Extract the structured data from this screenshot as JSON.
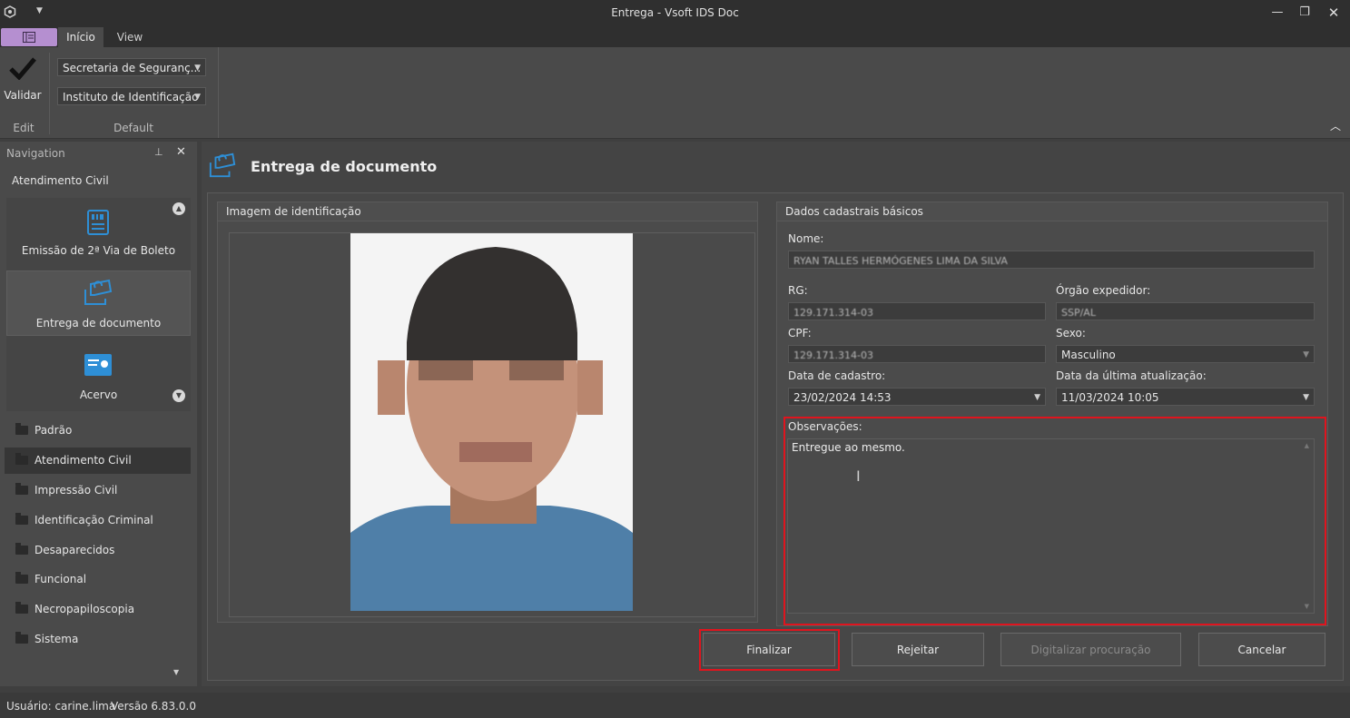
{
  "window": {
    "title": "Entrega - Vsoft IDS Doc"
  },
  "ribbon": {
    "tabs": [
      {
        "label": "Início"
      },
      {
        "label": "View"
      }
    ],
    "validar_label": "Validar",
    "combo1": "Secretaria de Seguranç...",
    "combo2": "Instituto de Identificação",
    "group_edit": "Edit",
    "group_default": "Default"
  },
  "navigation": {
    "header": "Navigation",
    "section": "Atendimento Civil",
    "tiles": [
      {
        "label": "Emissão de 2ª Via de Boleto",
        "icon": "barcode-icon"
      },
      {
        "label": "Entrega de documento",
        "icon": "document-delivery-icon"
      },
      {
        "label": "Acervo",
        "icon": "id-card-icon"
      }
    ],
    "folders": [
      {
        "label": "Padrão"
      },
      {
        "label": "Atendimento Civil"
      },
      {
        "label": "Impressão Civil"
      },
      {
        "label": "Identificação Criminal"
      },
      {
        "label": "Desaparecidos"
      },
      {
        "label": "Funcional"
      },
      {
        "label": "Necropapiloscopia"
      },
      {
        "label": "Sistema"
      }
    ]
  },
  "page": {
    "title": "Entrega de documento",
    "image_panel_title": "Imagem de identificação",
    "data_panel_title": "Dados cadastrais básicos",
    "fields": {
      "nome_label": "Nome:",
      "nome_value": "RYAN TALLES HERMÓGENES LIMA DA SILVA",
      "rg_label": "RG:",
      "rg_value": "129.171.314-03",
      "orgao_label": "Órgão expedidor:",
      "orgao_value": "SSP/AL",
      "cpf_label": "CPF:",
      "cpf_value": "129.171.314-03",
      "sexo_label": "Sexo:",
      "sexo_value": "Masculino",
      "cadastro_label": "Data de cadastro:",
      "cadastro_value": "23/02/2024 14:53",
      "atualizacao_label": "Data da última atualização:",
      "atualizacao_value": "11/03/2024 10:05",
      "observacoes_label": "Observações:",
      "observacoes_value": "Entregue ao mesmo."
    },
    "buttons": {
      "finalizar": "Finalizar",
      "rejeitar": "Rejeitar",
      "digitalizar": "Digitalizar procuração",
      "cancelar": "Cancelar"
    }
  },
  "status": {
    "usuario": "Usuário: carine.lima",
    "versao": "Versão 6.83.0.0"
  },
  "colors": {
    "highlight": "#e0141e",
    "accent": "#2e8fd6",
    "ribbon_file": "#b58fd0"
  }
}
